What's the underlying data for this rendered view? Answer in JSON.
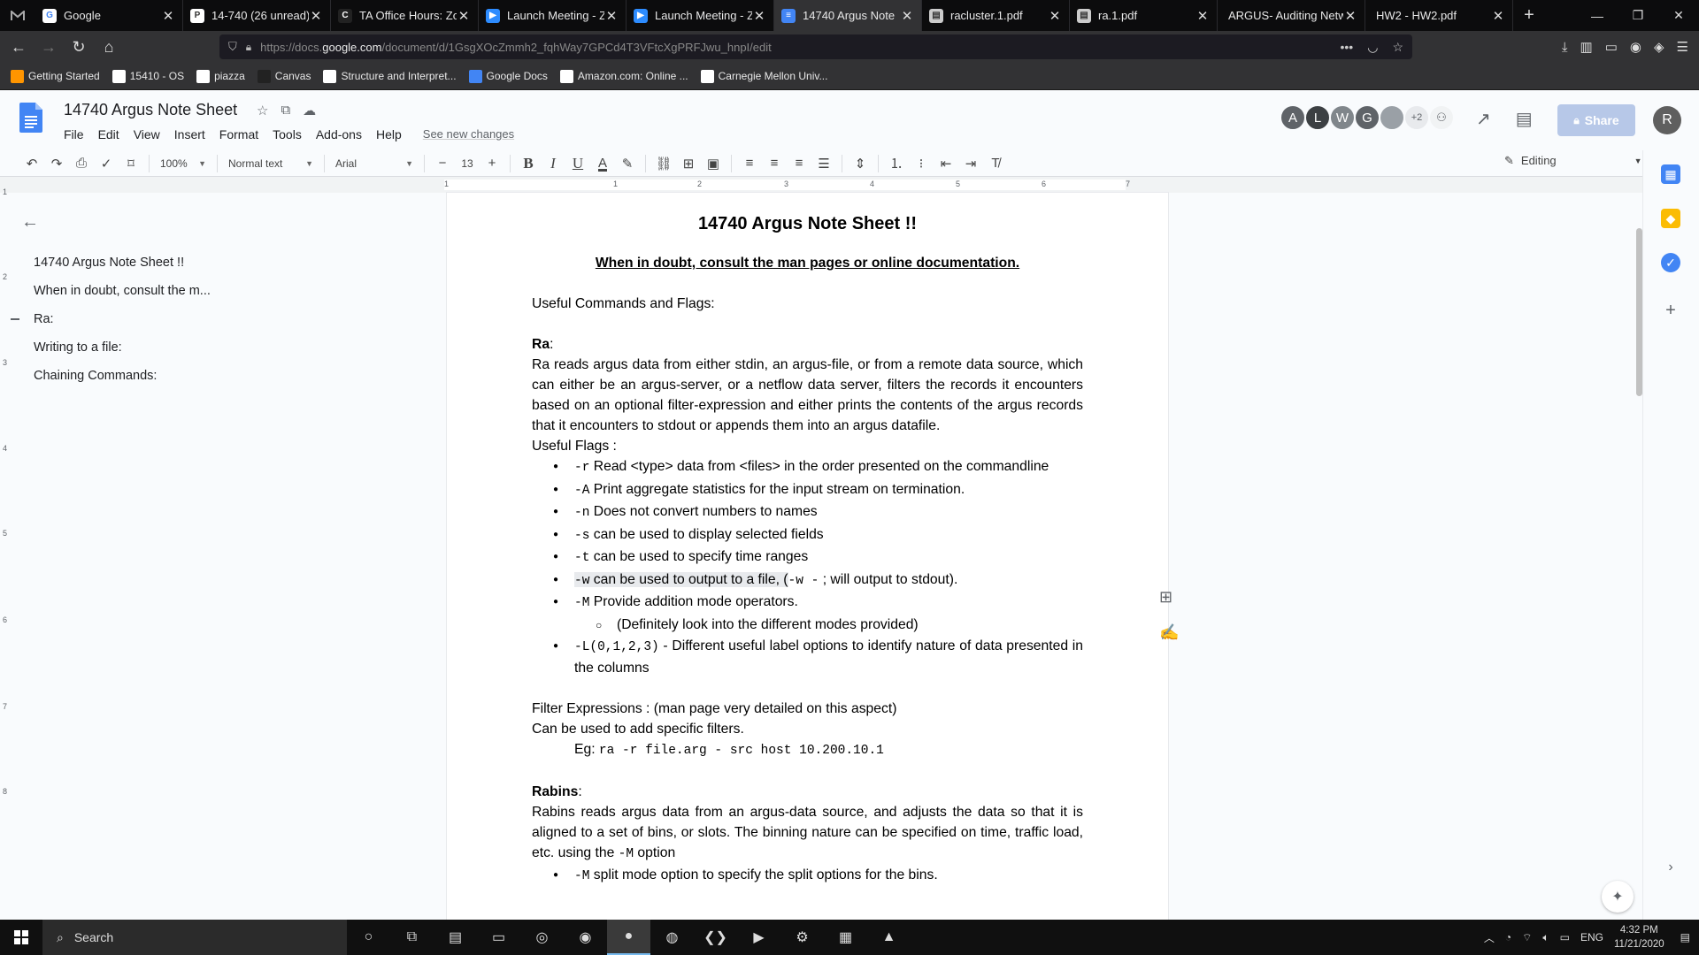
{
  "browser": {
    "tabs": [
      {
        "title": "Google",
        "fav_color": "#ffffff",
        "fav_text": "G",
        "fav_fg": "#4285f4"
      },
      {
        "title": "14-740 (26 unread)",
        "fav_color": "#ffffff",
        "fav_text": "P",
        "fav_fg": "#333"
      },
      {
        "title": "TA Office Hours: Zo",
        "fav_color": "#222",
        "fav_text": "C",
        "fav_fg": "#fff"
      },
      {
        "title": "Launch Meeting - Z",
        "fav_color": "#2d8cff",
        "fav_text": "▶",
        "fav_fg": "#fff"
      },
      {
        "title": "Launch Meeting - Z",
        "fav_color": "#2d8cff",
        "fav_text": "▶",
        "fav_fg": "#fff"
      },
      {
        "title": "14740 Argus Note",
        "fav_color": "#4285f4",
        "fav_text": "≡",
        "fav_fg": "#fff",
        "active": true
      },
      {
        "title": "racluster.1.pdf",
        "fav_color": "#ccc",
        "fav_text": "▤",
        "fav_fg": "#333"
      },
      {
        "title": "ra.1.pdf",
        "fav_color": "#ccc",
        "fav_text": "▤",
        "fav_fg": "#333"
      },
      {
        "title": "ARGUS- Auditing Netw",
        "fav_color": "",
        "fav_text": "",
        "fav_fg": ""
      },
      {
        "title": "HW2 - HW2.pdf",
        "fav_color": "",
        "fav_text": "",
        "fav_fg": ""
      }
    ],
    "url_prefix": "https://docs.",
    "url_domain": "google.com",
    "url_path": "/document/d/1GsgXOcZmmh2_fqhWay7GPCd4T3VFtcXgPRFJwu_hnpI/edit",
    "bookmarks": [
      {
        "label": "Getting Started",
        "color": "#ff9500"
      },
      {
        "label": "15410 - OS",
        "color": "#fff"
      },
      {
        "label": "piazza",
        "color": "#fff"
      },
      {
        "label": "Canvas",
        "color": "#222"
      },
      {
        "label": "Structure and Interpret...",
        "color": "#fff"
      },
      {
        "label": "Google Docs",
        "color": "#4285f4"
      },
      {
        "label": "Amazon.com: Online ...",
        "color": "#fff"
      },
      {
        "label": "Carnegie Mellon Univ...",
        "color": "#fff"
      }
    ]
  },
  "docs": {
    "title": "14740 Argus Note Sheet",
    "menu": [
      "File",
      "Edit",
      "View",
      "Insert",
      "Format",
      "Tools",
      "Add-ons",
      "Help"
    ],
    "see_changes": "See new changes",
    "avatars": [
      {
        "letter": "A",
        "color": "#5f6368"
      },
      {
        "letter": "L",
        "color": "#3c4043"
      },
      {
        "letter": "W",
        "color": "#80868b"
      },
      {
        "letter": "G",
        "color": "#5f6368"
      },
      {
        "letter": "",
        "color": "#9aa0a6"
      }
    ],
    "avatar_more": "+2",
    "share_label": "Share",
    "account_letter": "R",
    "toolbar": {
      "zoom": "100%",
      "style": "Normal text",
      "font": "Arial",
      "size": "13",
      "mode": "Editing"
    },
    "ruler_ticks": [
      "1",
      "1",
      "2",
      "3",
      "4",
      "5",
      "6",
      "7"
    ],
    "vruler_ticks": [
      "1",
      "2",
      "3",
      "4",
      "5",
      "6",
      "7",
      "8"
    ]
  },
  "outline": {
    "items": [
      {
        "label": "14740 Argus Note Sheet !!",
        "active": false
      },
      {
        "label": "When in doubt, consult the m...",
        "active": false
      },
      {
        "label": "Ra:",
        "active": true
      },
      {
        "label": "Writing to a file:",
        "active": false
      },
      {
        "label": "Chaining Commands:",
        "active": false
      }
    ]
  },
  "document": {
    "title": "14740 Argus Note Sheet !!",
    "subtitle": "When in doubt, consult the man pages or online documentation.",
    "useful_cmds": "Useful Commands and Flags:",
    "ra_heading": "Ra",
    "ra_colon": ":",
    "ra_desc": "Ra reads argus data from either stdin, an argus-file, or from a remote data source, which can either be an argus-server, or a netflow data server, filters the records it encounters based on an optional  filter-expression  and either prints the contents of the argus records that it encounters to stdout or appends them into an argus datafile.",
    "useful_flags": "Useful Flags :",
    "flags": [
      {
        "flag": "-r",
        "text": " Read <type> data from <files> in the order presented on the commandline"
      },
      {
        "flag": "-A",
        "text": " Print aggregate statistics for the input stream on termination."
      },
      {
        "flag": "-n",
        "text": " Does not convert numbers to names"
      },
      {
        "flag": "-s",
        "text": " can be used to display selected fields"
      },
      {
        "flag": "-t",
        "text": " can be used to specify time ranges"
      },
      {
        "flag": "-w",
        "text": " can be used to output to a file, (",
        "extra_mono": "-w -",
        "extra_text": " ; will output to stdout)."
      },
      {
        "flag": "-M",
        "text": " Provide addition mode operators."
      }
    ],
    "sub_flag": "(Definitely look into the different modes provided)",
    "label_flag": "-L(0,1,2,3)",
    "label_text": " - Different useful label options to identify nature of data presented in the columns",
    "filter_heading": "Filter Expressions : (man page very detailed on this aspect)",
    "filter_desc": "Can be used to add specific filters.",
    "eg_label": "Eg:  ",
    "eg_code": "ra -r file.arg - src host 10.200.10.1",
    "rabins_heading": "Rabins",
    "rabins_desc": "Rabins reads argus data from an argus-data source, and adjusts the data so that it is aligned to a set of bins, or slots. The binning nature can be specified on time, traffic load, etc. using the ",
    "rabins_flag": "-M",
    "rabins_tail": " option",
    "rabins_item_flag": "-M",
    "rabins_item_text": " split mode option to specify the split options for the bins."
  },
  "taskbar": {
    "search_placeholder": "Search",
    "lang": "ENG",
    "time": "4:32 PM",
    "date": "11/21/2020"
  }
}
